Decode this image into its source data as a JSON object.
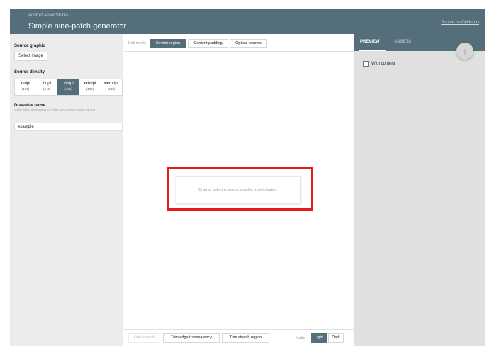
{
  "header": {
    "back_icon": "arrow-left-icon",
    "app_subtitle": "Android Asset Studio",
    "title": "Simple nine-patch generator",
    "github_link": "Source on GitHub",
    "external_icon": "external-link-icon"
  },
  "left_panel": {
    "source_graphic_label": "Source graphic",
    "select_image_label": "Select image",
    "source_density_label": "Source density",
    "densities": [
      {
        "name": "mdpi",
        "dpi": "(160)",
        "selected": false
      },
      {
        "name": "hdpi",
        "dpi": "(240)",
        "selected": false
      },
      {
        "name": "xhdpi",
        "dpi": "(320)",
        "selected": true
      },
      {
        "name": "xxhdpi",
        "dpi": "(480)",
        "selected": false
      },
      {
        "name": "xxxhdpi",
        "dpi": "(640)",
        "selected": false
      }
    ],
    "drawable_name_label": "Drawable name",
    "drawable_name_hint": "Used when generating ZIP files. Becomes <name>.9.png",
    "drawable_name_value": "example"
  },
  "center": {
    "edit_mode_label": "Edit mode",
    "modes": [
      "Stretch region",
      "Content padding",
      "Optical bounds"
    ],
    "selected_mode": "Stretch region",
    "empty_message": "Drag or select a source graphic to get started.",
    "auto_stretch_label": "Auto-stretch",
    "trim_edge_label": "Trim edge transparency",
    "trim_stretch_label": "Trim stretch region",
    "matte_label": "Matte",
    "matte_light": "Light",
    "matte_dark": "Dark",
    "selected_matte": "Light"
  },
  "right_panel": {
    "tab_preview": "PREVIEW",
    "tab_assets": "ASSETS",
    "download_icon": "download-icon",
    "with_content_label": "With content"
  },
  "colors": {
    "primary": "#546e7a",
    "highlight": "#e21b1b",
    "panel_bg": "#e0e0e0"
  }
}
